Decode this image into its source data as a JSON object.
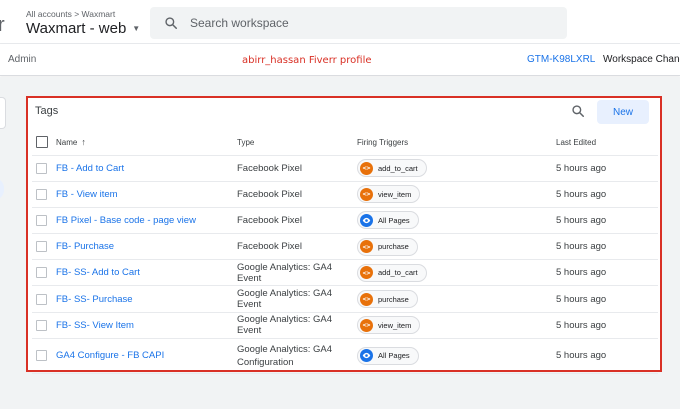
{
  "header": {
    "breadcrumb": "All accounts > Waxmart",
    "container_title": "Waxmart - web",
    "search_placeholder": "Search workspace"
  },
  "subheader": {
    "admin_label": "Admin",
    "promo_text": "abirr_hassan Fiverr profile",
    "container_id": "GTM-K98LXRL",
    "workspace_label": "Workspace Chang"
  },
  "tags_card": {
    "title": "Tags",
    "new_button": "New",
    "columns": {
      "name": "Name",
      "type": "Type",
      "triggers": "Firing Triggers",
      "last_edited": "Last Edited"
    },
    "rows": [
      {
        "name": "FB - Add to Cart",
        "type": "Facebook Pixel",
        "trigger": "add_to_cart",
        "trigger_icon": "code-icon",
        "edited": "5 hours ago"
      },
      {
        "name": "FB - View item",
        "type": "Facebook Pixel",
        "trigger": "view_item",
        "trigger_icon": "code-icon",
        "edited": "5 hours ago"
      },
      {
        "name": "FB Pixel - Base code - page view",
        "type": "Facebook Pixel",
        "trigger": "All Pages",
        "trigger_icon": "eye-icon",
        "edited": "5 hours ago"
      },
      {
        "name": "FB- Purchase",
        "type": "Facebook Pixel",
        "trigger": "purchase",
        "trigger_icon": "code-icon",
        "edited": "5 hours ago"
      },
      {
        "name": "FB- SS- Add to Cart",
        "type": "Google Analytics: GA4 Event",
        "trigger": "add_to_cart",
        "trigger_icon": "code-icon",
        "edited": "5 hours ago"
      },
      {
        "name": "FB- SS- Purchase",
        "type": "Google Analytics: GA4 Event",
        "trigger": "purchase",
        "trigger_icon": "code-icon",
        "edited": "5 hours ago"
      },
      {
        "name": "FB- SS- View Item",
        "type": "Google Analytics: GA4 Event",
        "trigger": "view_item",
        "trigger_icon": "code-icon",
        "edited": "5 hours ago"
      },
      {
        "name": "GA4 Configure - FB CAPI",
        "type": "Google Analytics: GA4 Configuration",
        "trigger": "All Pages",
        "trigger_icon": "eye-icon",
        "edited": "5 hours ago"
      }
    ]
  },
  "colors": {
    "accent": "#1a73e8",
    "highlight_border": "#d93025",
    "custom_event_icon": "#e8710a",
    "pageview_icon": "#1a73e8"
  }
}
